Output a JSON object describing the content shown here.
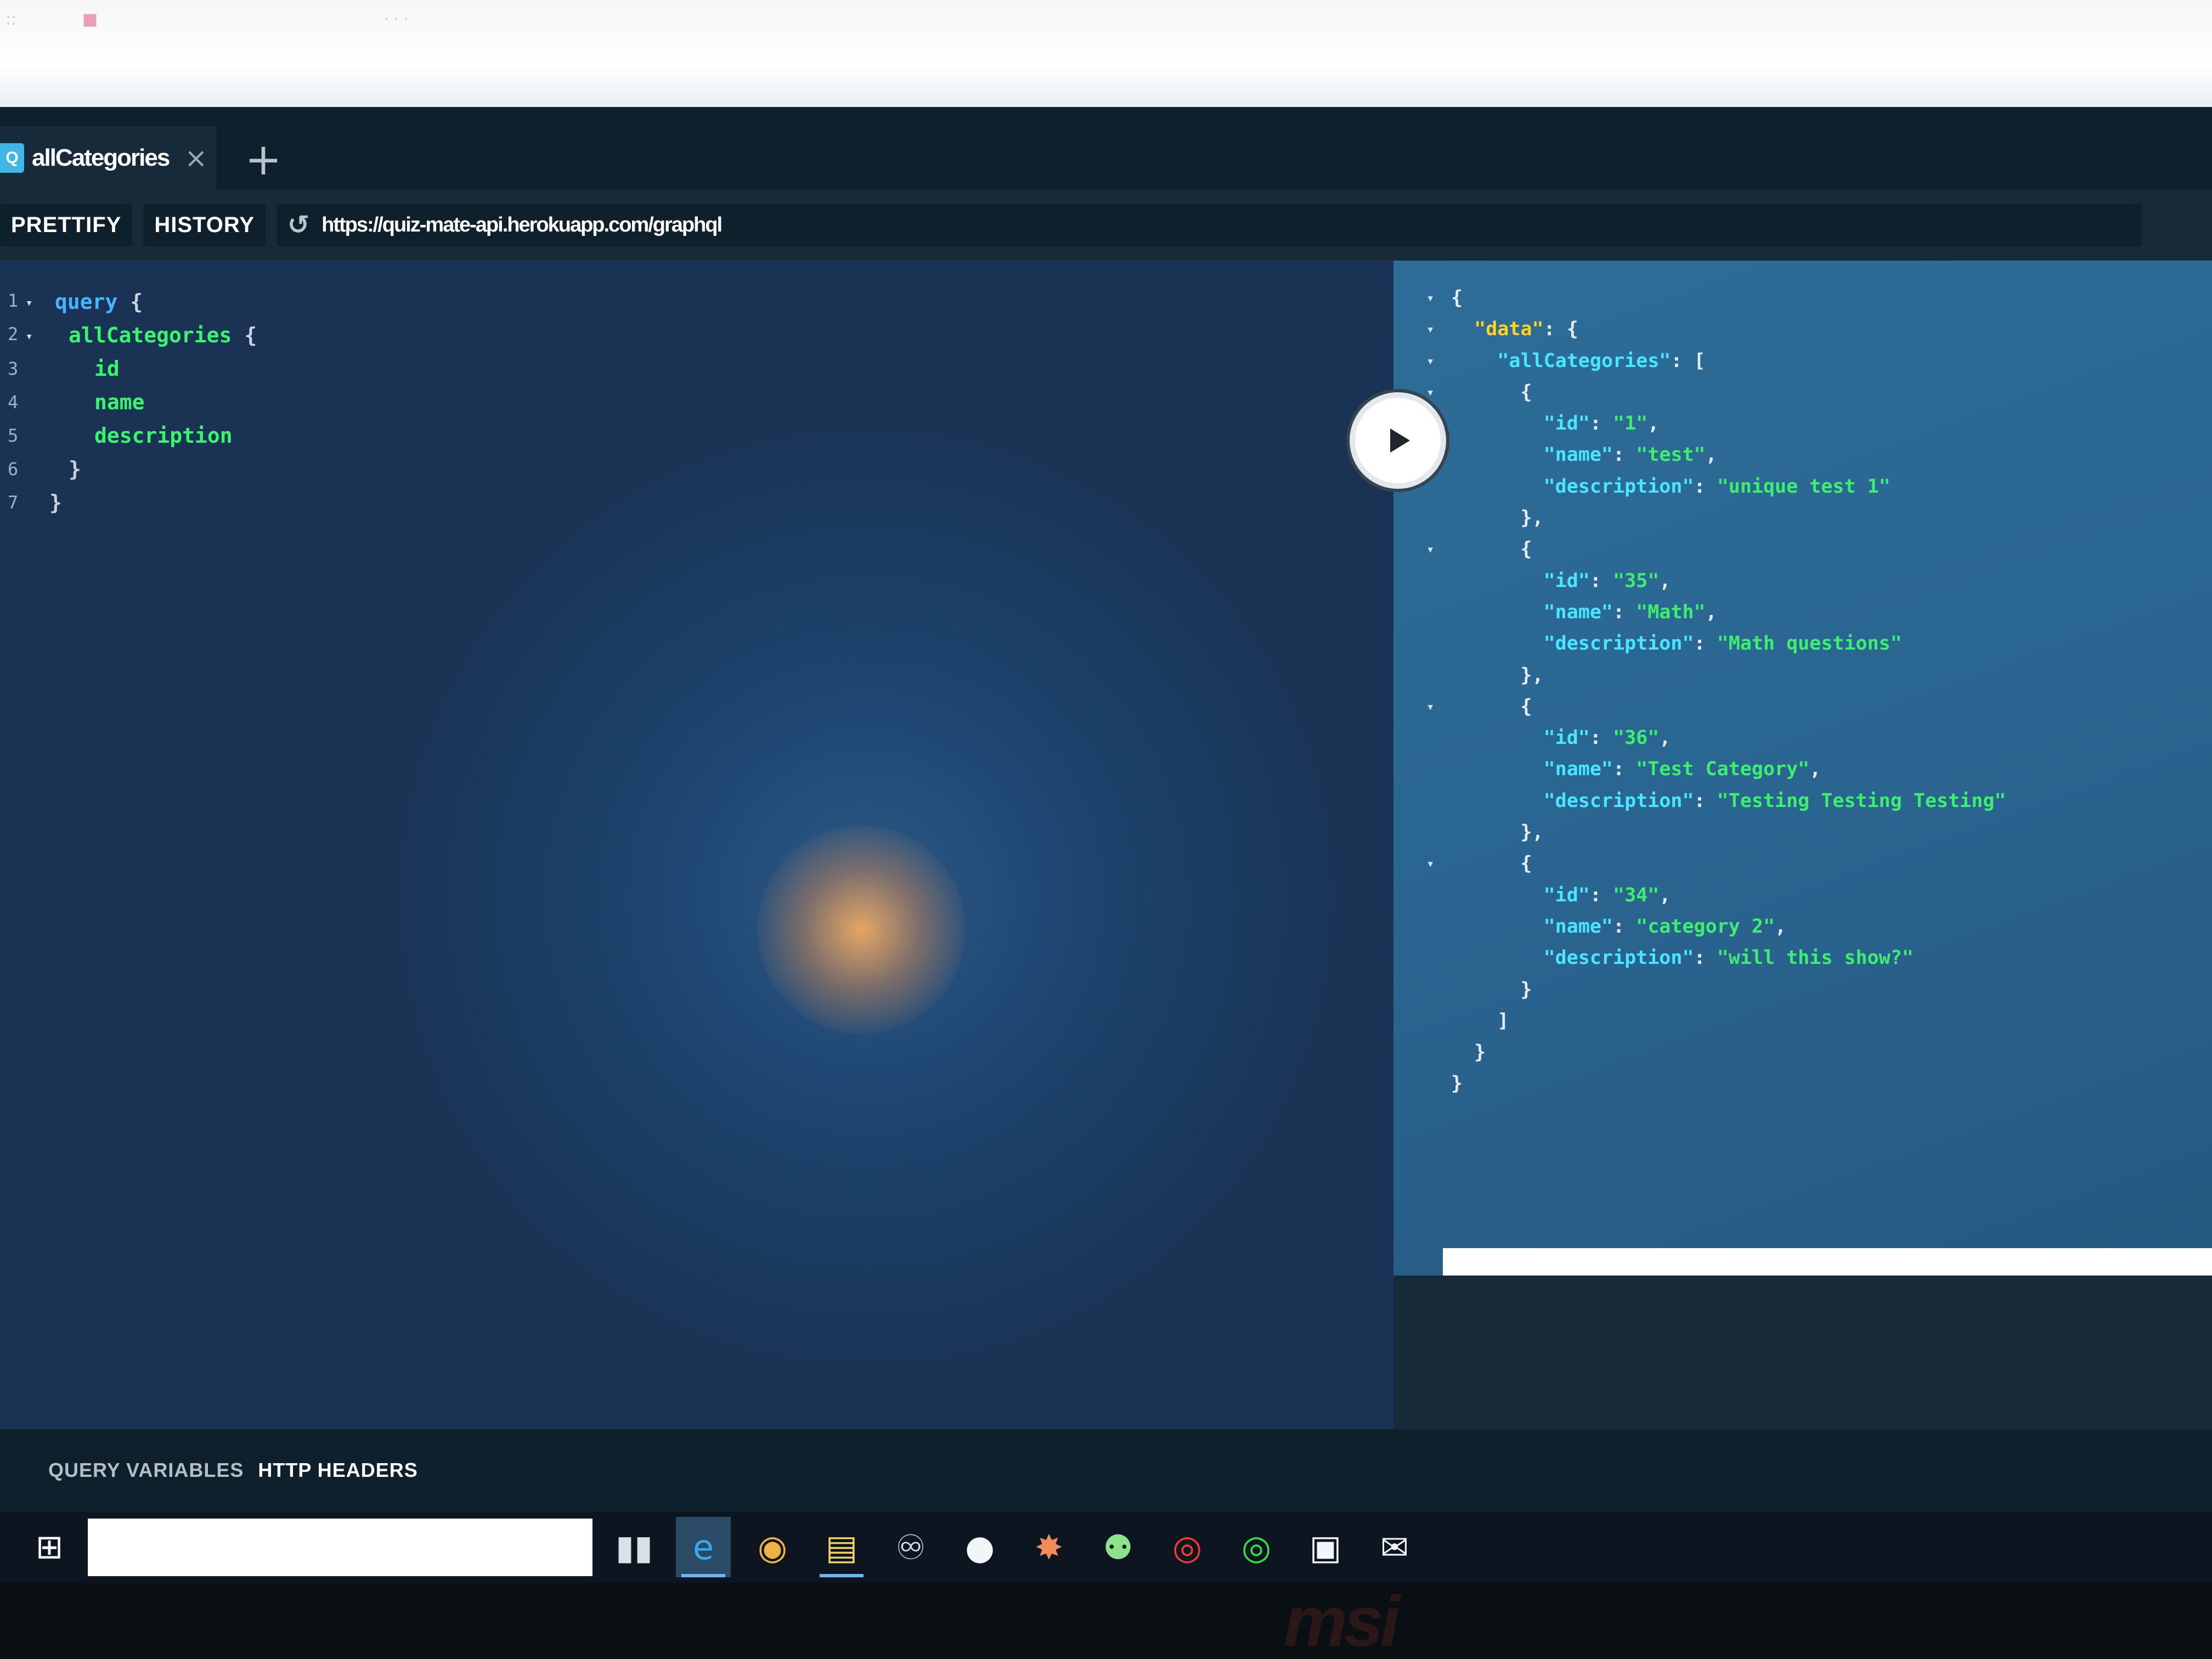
{
  "browser": {
    "ghost_left": "::",
    "ghost_mid": "■",
    "ghost_right": "· · ·"
  },
  "tab": {
    "logo": "Q",
    "title": "allCategories",
    "close_icon": "×",
    "add_icon": "+"
  },
  "toolbar": {
    "prettify_label": "PRETTIFY",
    "history_label": "HISTORY",
    "reload_icon": "↺",
    "endpoint_url": "https://quiz-mate-api.herokuapp.com/graphql"
  },
  "editor": {
    "line_numbers": [
      "1",
      "2",
      "3",
      "4",
      "5",
      "6",
      "7"
    ],
    "query_keyword": "query",
    "root_field": "allCategories",
    "fields": [
      "id",
      "name",
      "description"
    ],
    "open_brace": "{",
    "close_brace": "}"
  },
  "result": {
    "data_key": "\"data\"",
    "list_key": "\"allCategories\"",
    "items": [
      {
        "id": "\"1\"",
        "name": "\"test\"",
        "description": "\"unique test 1\""
      },
      {
        "id": "\"35\"",
        "name": "\"Math\"",
        "description": "\"Math questions\""
      },
      {
        "id": "\"36\"",
        "name": "\"Test Category\"",
        "description": "\"Testing Testing Testing\""
      },
      {
        "id": "\"34\"",
        "name": "\"category 2\"",
        "description": "\"will this show?\""
      }
    ],
    "key_id": "\"id\"",
    "key_name": "\"name\"",
    "key_description": "\"description\""
  },
  "bottom": {
    "query_variables_label": "QUERY VARIABLES",
    "http_headers_label": "HTTP HEADERS"
  },
  "taskbar": {
    "start_icon": "⊞",
    "icons": [
      {
        "name": "task-view-icon",
        "glyph": "▮▮",
        "color": "#d8e0e8"
      },
      {
        "name": "edge-icon",
        "glyph": "e",
        "color": "#39a7ee"
      },
      {
        "name": "chrome-icon",
        "glyph": "◉",
        "color": "#f0b340"
      },
      {
        "name": "file-explorer-icon",
        "glyph": "▤",
        "color": "#f5d35c"
      },
      {
        "name": "steam-icon",
        "glyph": "♾",
        "color": "#cfe3f5"
      },
      {
        "name": "chat-icon",
        "glyph": "●",
        "color": "#f2f6f8"
      },
      {
        "name": "paint-icon",
        "glyph": "✸",
        "color": "#f08c5a"
      },
      {
        "name": "android-icon",
        "glyph": "⚉",
        "color": "#8de38a"
      },
      {
        "name": "red-app-icon",
        "glyph": "◎",
        "color": "#ef3b30"
      },
      {
        "name": "green-app-icon",
        "glyph": "◎",
        "color": "#2fe042"
      },
      {
        "name": "store-icon",
        "glyph": "▣",
        "color": "#f2f6f8"
      },
      {
        "name": "mail-icon",
        "glyph": "✉",
        "color": "#f2f6f8"
      }
    ]
  },
  "monitor": {
    "brand": "msi"
  }
}
